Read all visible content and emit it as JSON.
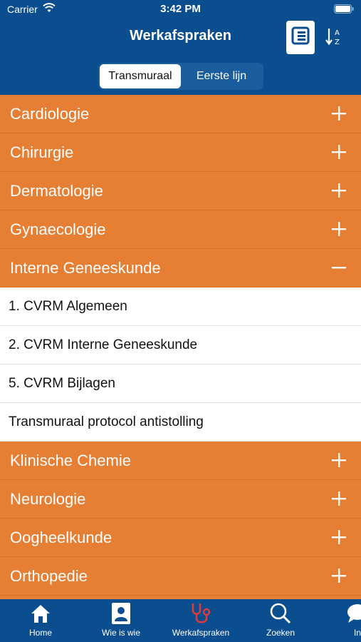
{
  "status_bar": {
    "carrier": "Carrier",
    "time": "3:42 PM"
  },
  "nav": {
    "title": "Werkafspraken"
  },
  "segments": [
    {
      "label": "Transmuraal",
      "active": true
    },
    {
      "label": "Eerste lijn",
      "active": false
    }
  ],
  "list": {
    "sections_before": [
      {
        "label": "Cardiologie",
        "toggle": "plus"
      },
      {
        "label": "Chirurgie",
        "toggle": "plus"
      },
      {
        "label": "Dermatologie",
        "toggle": "plus"
      },
      {
        "label": "Gynaecologie",
        "toggle": "plus"
      },
      {
        "label": "Interne Geneeskunde",
        "toggle": "minus"
      }
    ],
    "expanded_items": [
      {
        "label": "1. CVRM Algemeen"
      },
      {
        "label": "2. CVRM Interne Geneeskunde"
      },
      {
        "label": "5. CVRM Bijlagen"
      },
      {
        "label": "Transmuraal protocol antistolling"
      }
    ],
    "sections_after": [
      {
        "label": "Klinische Chemie",
        "toggle": "plus"
      },
      {
        "label": "Neurologie",
        "toggle": "plus"
      },
      {
        "label": "Oogheelkunde",
        "toggle": "plus"
      },
      {
        "label": "Orthopedie",
        "toggle": "plus"
      }
    ]
  },
  "tabbar": {
    "tabs": [
      {
        "label": "Home",
        "icon": "home-icon",
        "active": false
      },
      {
        "label": "Wie is wie",
        "icon": "person-card-icon",
        "active": false
      },
      {
        "label": "Werkafspraken",
        "icon": "stethoscope-icon",
        "active": true
      },
      {
        "label": "Zoeken",
        "icon": "search-icon",
        "active": false
      },
      {
        "label": "In",
        "icon": "chat-icon",
        "active": false
      }
    ]
  },
  "colors": {
    "header_blue": "#0b4e8f",
    "section_orange": "#e67e33",
    "active_tab_icon": "#e03a3a"
  }
}
